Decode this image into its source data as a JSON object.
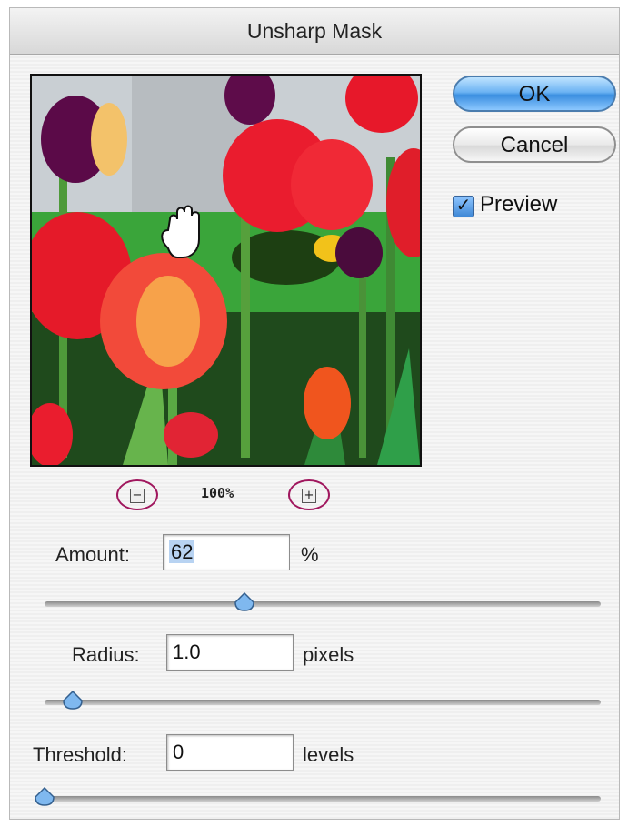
{
  "dialog": {
    "title": "Unsharp Mask"
  },
  "buttons": {
    "ok": "OK",
    "cancel": "Cancel"
  },
  "preview_option": {
    "label": "Preview",
    "checked": true,
    "check_glyph": "✓"
  },
  "zoom": {
    "level": "100%",
    "minus_glyph": "−",
    "plus_glyph": "+",
    "minus_icon": "zoom-out-icon",
    "plus_icon": "zoom-in-icon"
  },
  "fields": {
    "amount": {
      "label": "Amount:",
      "value": "62",
      "unit": "%",
      "slider_fraction": 0.36
    },
    "radius": {
      "label": "Radius:",
      "value": "1.0",
      "unit": "pixels",
      "slider_fraction": 0.05
    },
    "threshold": {
      "label": "Threshold:",
      "value": "0",
      "unit": "levels",
      "slider_fraction": 0.0
    }
  },
  "colors": {
    "accent": "#3a8ee0",
    "highlight_circle": "#a0175e"
  }
}
